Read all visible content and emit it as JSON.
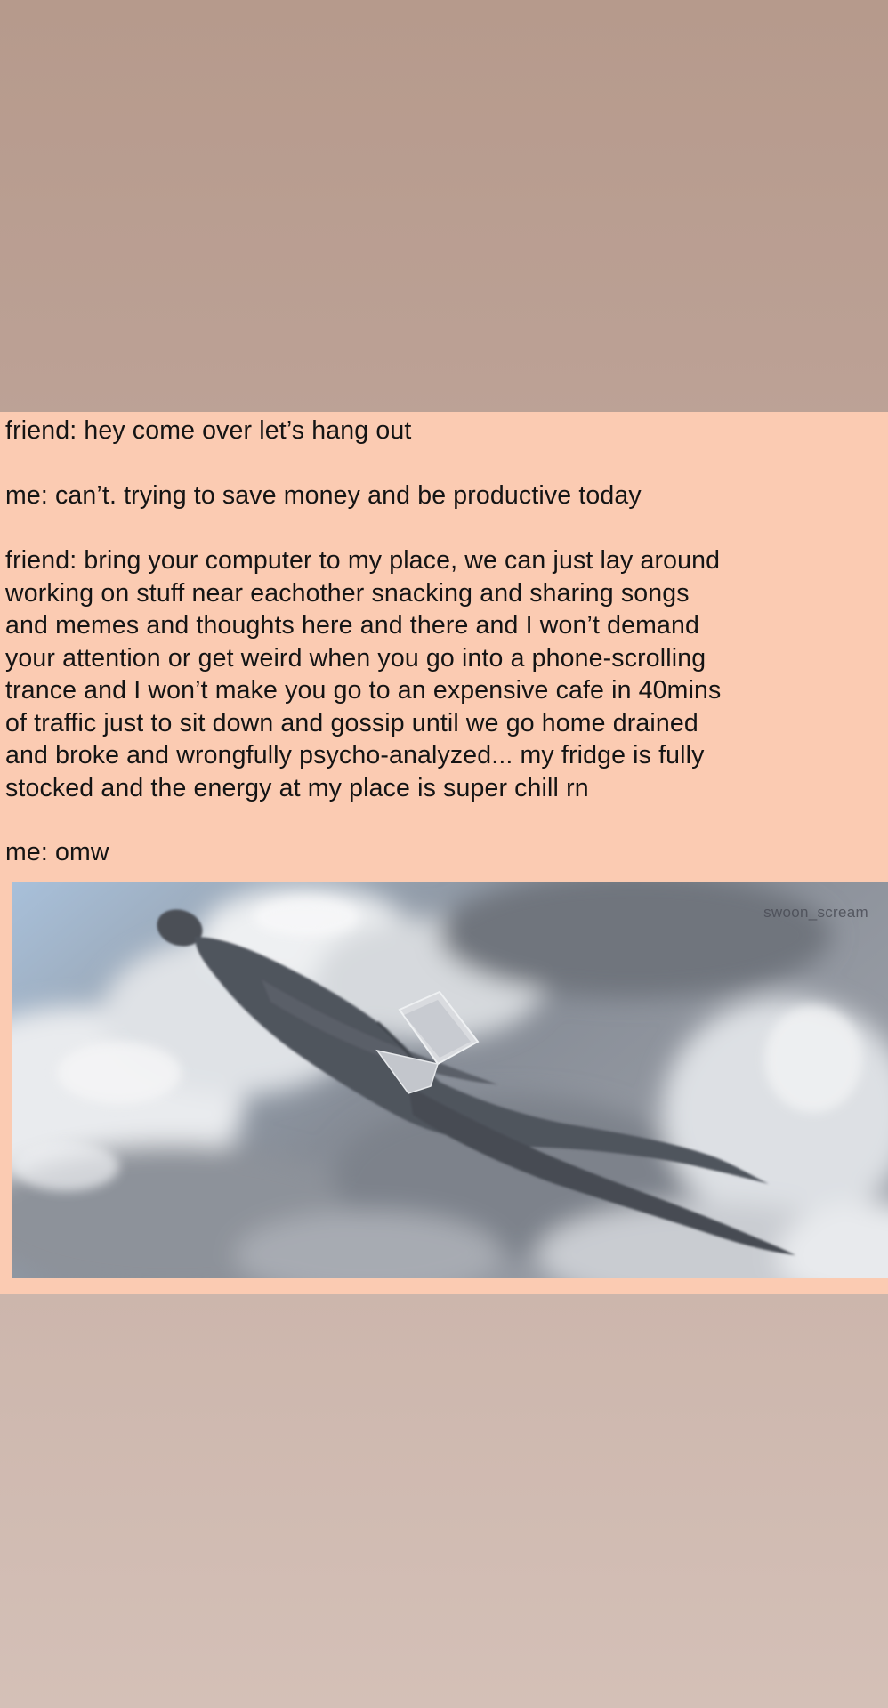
{
  "meme": {
    "caption_lines": [
      "friend: hey come over let’s hang out",
      "me: can’t. trying to save money and be productive today",
      "friend: bring your computer to my place, we can just lay around",
      "working on stuff near eachother snacking and sharing songs",
      "and memes and thoughts here and there and I won’t demand",
      "your attention or get weird when you go into a phone-scrolling",
      "trance and I won’t make you go to an expensive cafe in 40mins",
      "of traffic just to sit down and gossip until we go home drained",
      "and broke and wrongfully psycho-analyzed... my fridge is fully",
      "stocked and the energy at my place is super chill rn",
      "me: omw"
    ],
    "watermark": "swoon_scream"
  },
  "colors": {
    "background_top": "#b69a8c",
    "background_bottom": "#d4c0b7",
    "card": "#fbcbb2",
    "text": "#141414",
    "sky": "#8f97a3",
    "figure": "#4e525b"
  }
}
